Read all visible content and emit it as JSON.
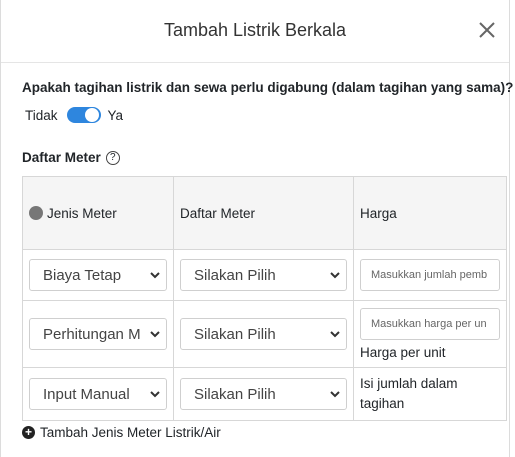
{
  "modal": {
    "title": "Tambah Listrik Berkala"
  },
  "question": "Apakah tagihan listrik dan sewa perlu digabung (dalam tagihan yang sama)?",
  "toggle": {
    "off_label": "Tidak",
    "on_label": "Ya",
    "checked": true
  },
  "section_title": "Daftar Meter",
  "table": {
    "headers": [
      "Jenis Meter",
      "Daftar Meter",
      "Harga"
    ],
    "rows": [
      {
        "type": "Biaya Tetap",
        "meter": "Silakan Pilih",
        "price_placeholder": "Masukkan jumlah pemb",
        "note": ""
      },
      {
        "type": "Perhitungan M",
        "meter": "Silakan Pilih",
        "price_placeholder": "Masukkan harga per un",
        "note": "Harga per unit"
      },
      {
        "type": "Input Manual",
        "meter": "Silakan Pilih",
        "price_placeholder": "",
        "note": "Isi jumlah dalam tagihan"
      }
    ]
  },
  "add_label": "Tambah Jenis Meter Listrik/Air",
  "colors": {
    "accent": "#2e86de",
    "header_bg": "#f5f5f5",
    "border": "#d7d7d7"
  }
}
